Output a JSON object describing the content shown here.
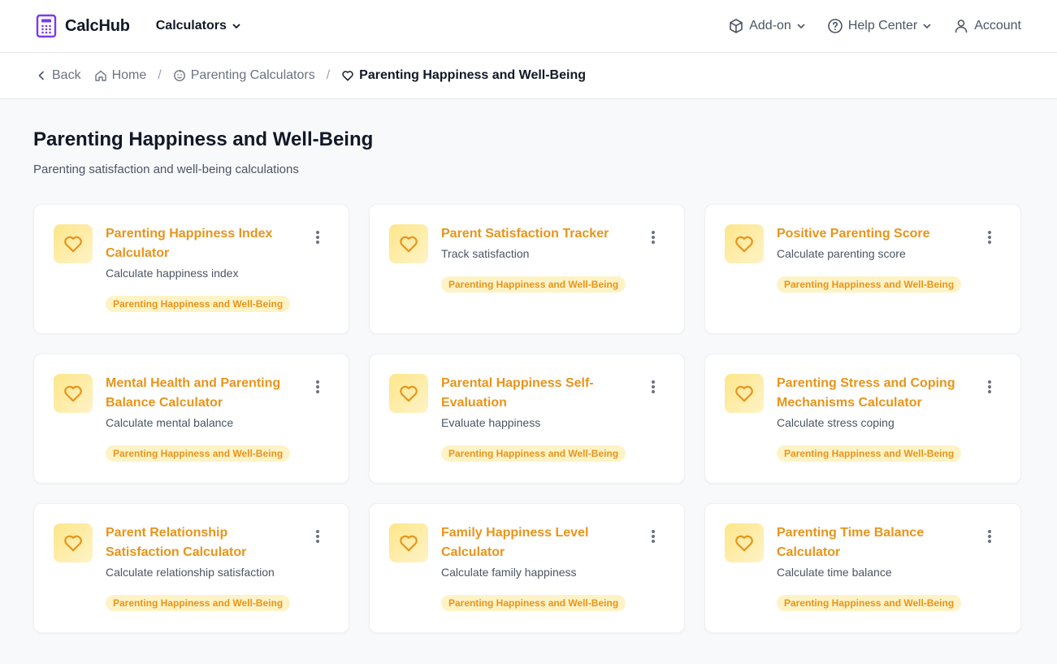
{
  "header": {
    "brand": "CalcHub",
    "calculators_label": "Calculators",
    "addon_label": "Add-on",
    "help_label": "Help Center",
    "account_label": "Account"
  },
  "breadcrumb": {
    "back": "Back",
    "home": "Home",
    "parent": "Parenting Calculators",
    "current": "Parenting Happiness and Well-Being"
  },
  "page": {
    "title": "Parenting Happiness and Well-Being",
    "subtitle": "Parenting satisfaction and well-being calculations"
  },
  "colors": {
    "accent": "#e8941a",
    "icon_bg": "#fde68a",
    "tag_bg": "#fef3c7",
    "logo": "#7c3aed"
  },
  "cards": [
    {
      "title": "Parenting Happiness Index Calculator",
      "desc": "Calculate happiness index",
      "tag": "Parenting Happiness and Well-Being",
      "icon": "heart-icon"
    },
    {
      "title": "Parent Satisfaction Tracker",
      "desc": "Track satisfaction",
      "tag": "Parenting Happiness and Well-Being",
      "icon": "heart-icon"
    },
    {
      "title": "Positive Parenting Score",
      "desc": "Calculate parenting score",
      "tag": "Parenting Happiness and Well-Being",
      "icon": "heart-icon"
    },
    {
      "title": "Mental Health and Parenting Balance Calculator",
      "desc": "Calculate mental balance",
      "tag": "Parenting Happiness and Well-Being",
      "icon": "heart-icon"
    },
    {
      "title": "Parental Happiness Self-Evaluation",
      "desc": "Evaluate happiness",
      "tag": "Parenting Happiness and Well-Being",
      "icon": "heart-icon"
    },
    {
      "title": "Parenting Stress and Coping Mechanisms Calculator",
      "desc": "Calculate stress coping",
      "tag": "Parenting Happiness and Well-Being",
      "icon": "heart-icon"
    },
    {
      "title": "Parent Relationship Satisfaction Calculator",
      "desc": "Calculate relationship satisfaction",
      "tag": "Parenting Happiness and Well-Being",
      "icon": "heart-icon"
    },
    {
      "title": "Family Happiness Level Calculator",
      "desc": "Calculate family happiness",
      "tag": "Parenting Happiness and Well-Being",
      "icon": "heart-icon"
    },
    {
      "title": "Parenting Time Balance Calculator",
      "desc": "Calculate time balance",
      "tag": "Parenting Happiness and Well-Being",
      "icon": "heart-icon"
    }
  ]
}
